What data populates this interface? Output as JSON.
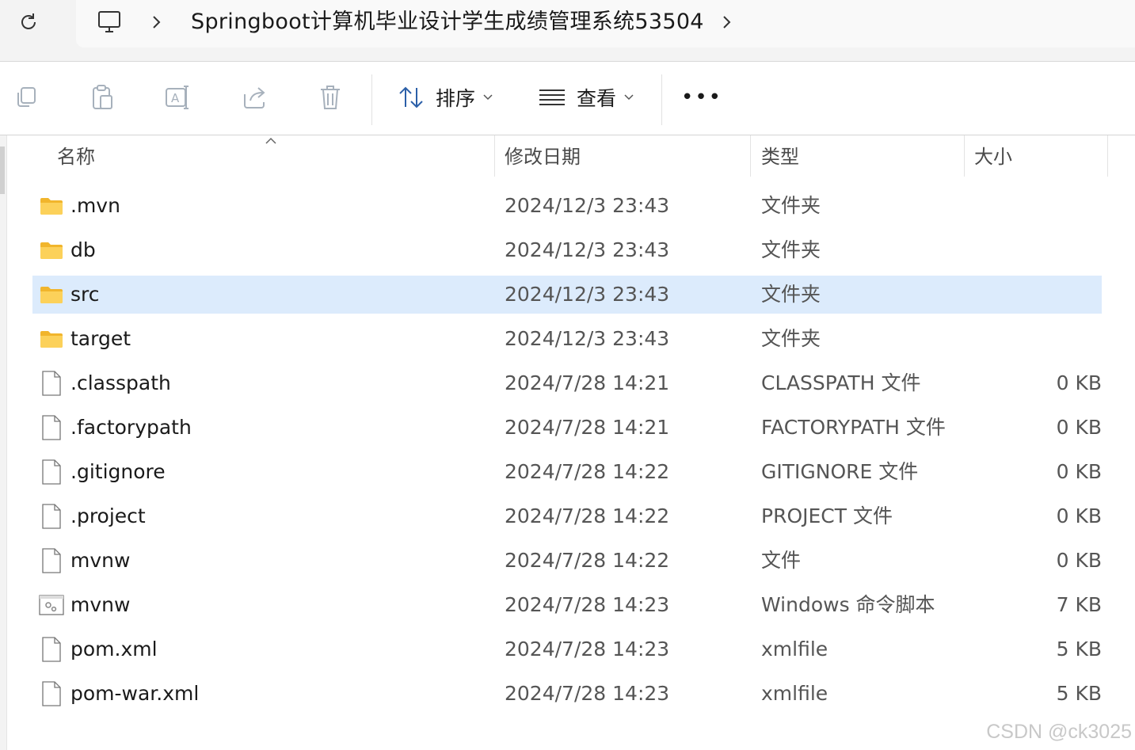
{
  "address_bar": {
    "refresh_icon": "refresh-icon",
    "pc_icon": "this-pc-icon",
    "path": "Springboot计算机毕业设计学生成绩管理系统53504"
  },
  "command_bar": {
    "buttons": [
      "copy-icon",
      "paste-icon",
      "rename-icon",
      "share-icon",
      "delete-icon"
    ],
    "sort_label": "排序",
    "view_label": "查看",
    "more_label": "•••"
  },
  "columns": {
    "name": "名称",
    "modified": "修改日期",
    "type": "类型",
    "size": "大小"
  },
  "files": [
    {
      "name": ".mvn",
      "modified": "2024/12/3 23:43",
      "type": "文件夹",
      "size": "",
      "icon": "folder-icon",
      "selected": false
    },
    {
      "name": "db",
      "modified": "2024/12/3 23:43",
      "type": "文件夹",
      "size": "",
      "icon": "folder-icon",
      "selected": false
    },
    {
      "name": "src",
      "modified": "2024/12/3 23:43",
      "type": "文件夹",
      "size": "",
      "icon": "folder-icon",
      "selected": true
    },
    {
      "name": "target",
      "modified": "2024/12/3 23:43",
      "type": "文件夹",
      "size": "",
      "icon": "folder-icon",
      "selected": false
    },
    {
      "name": ".classpath",
      "modified": "2024/7/28 14:21",
      "type": "CLASSPATH 文件",
      "size": "0 KB",
      "icon": "file-icon",
      "selected": false
    },
    {
      "name": ".factorypath",
      "modified": "2024/7/28 14:21",
      "type": "FACTORYPATH 文件",
      "size": "0 KB",
      "icon": "file-icon",
      "selected": false
    },
    {
      "name": ".gitignore",
      "modified": "2024/7/28 14:22",
      "type": "GITIGNORE 文件",
      "size": "0 KB",
      "icon": "file-icon",
      "selected": false
    },
    {
      "name": ".project",
      "modified": "2024/7/28 14:22",
      "type": "PROJECT 文件",
      "size": "0 KB",
      "icon": "file-icon",
      "selected": false
    },
    {
      "name": "mvnw",
      "modified": "2024/7/28 14:22",
      "type": "文件",
      "size": "0 KB",
      "icon": "file-icon",
      "selected": false
    },
    {
      "name": "mvnw",
      "modified": "2024/7/28 14:23",
      "type": "Windows 命令脚本",
      "size": "7 KB",
      "icon": "script-icon",
      "selected": false
    },
    {
      "name": "pom.xml",
      "modified": "2024/7/28 14:23",
      "type": "xmlfile",
      "size": "5 KB",
      "icon": "file-icon",
      "selected": false
    },
    {
      "name": "pom-war.xml",
      "modified": "2024/7/28 14:23",
      "type": "xmlfile",
      "size": "5 KB",
      "icon": "file-icon",
      "selected": false
    }
  ],
  "watermark": "CSDN @ck3025",
  "colors": {
    "selection": "#dcebfc",
    "folder": "#f5c242",
    "toolbar_icon": "#9aa6b2"
  }
}
